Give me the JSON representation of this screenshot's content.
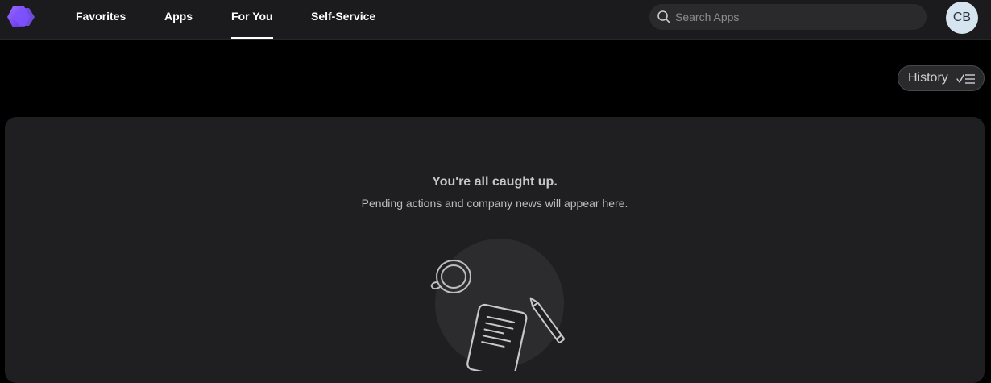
{
  "nav": {
    "tabs": [
      {
        "label": "Favorites"
      },
      {
        "label": "Apps"
      },
      {
        "label": "For You"
      },
      {
        "label": "Self-Service"
      }
    ],
    "active_tab": "For You"
  },
  "search": {
    "placeholder": "Search Apps",
    "value": ""
  },
  "user": {
    "initials": "CB"
  },
  "toolbar": {
    "history_label": "History"
  },
  "empty_state": {
    "title": "You're all caught up.",
    "subtitle": "Pending actions and company news will appear here."
  },
  "icons": {
    "logo": "hexagon-logo-icon",
    "search": "search-icon",
    "history": "checklist-icon",
    "illustration": "coffee-paper-pencil-illustration"
  },
  "colors": {
    "brand": "#7b4dff",
    "background": "#000000",
    "topbar": "#1b1b1d",
    "panel": "#1f1f21",
    "avatar": "#d6e4ef"
  }
}
